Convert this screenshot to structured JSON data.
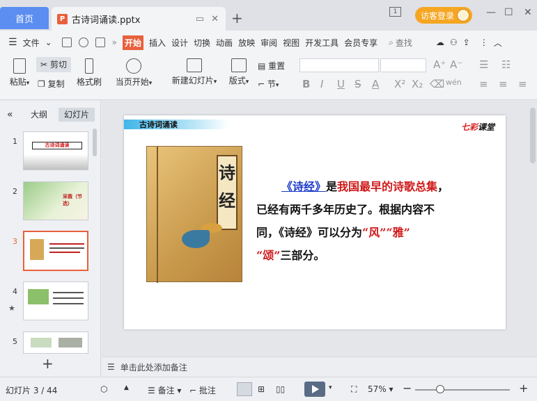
{
  "titlebar": {
    "home_tab": "首页",
    "doc_tab": "古诗词诵读.pptx",
    "file_badge": "P",
    "add_tab": "+",
    "visitor_login": "访客登录",
    "page_badge": "1"
  },
  "menubar": {
    "items": [
      "文件",
      "开始",
      "插入",
      "设计",
      "切换",
      "动画",
      "放映",
      "审阅",
      "视图",
      "开发工具",
      "会员专享"
    ],
    "active_item": "开始",
    "search": "查找"
  },
  "ribbon": {
    "paste": "粘贴",
    "cut": "剪切",
    "copy": "复制",
    "format_painter": "格式刷",
    "start_from_current": "当页开始",
    "new_slide": "新建幻灯片",
    "layout": "版式",
    "reset": "重置",
    "section": "节",
    "font_bold": "B",
    "font_italic": "I",
    "font_underline": "U",
    "font_strike": "S",
    "font_color": "A",
    "superscript": "X²",
    "subscript": "X₂",
    "pinyin": "wén"
  },
  "leftpanel": {
    "tab_outline": "大纲",
    "tab_slides": "幻灯片",
    "thumb_numbers": [
      "1",
      "2",
      "3",
      "4",
      "5"
    ],
    "thumb1_title": "古诗词诵读",
    "thumb2_title": "采薇（节选）",
    "add_slide": "+"
  },
  "slide": {
    "header_band": "古诗词诵读",
    "brand_red": "七彩",
    "brand_black": "课堂",
    "book_title": "诗经",
    "line1_title": "《诗经》",
    "line1_mid": "是",
    "line1_red": "我国最早的诗歌总集",
    "line1_end": "，",
    "line2": "已经有两千多年历史了。根据内容不",
    "line3_start": "同，《诗经》可以分为",
    "line3_red": "“风”“雅”",
    "line4_red": "“颂”",
    "line4_end": "三部分。"
  },
  "notes": {
    "placeholder": "单击此处添加备注"
  },
  "status": {
    "slide_count": "幻灯片 3 / 44",
    "notes_btn": "备注",
    "comment_btn": "批注",
    "zoom": "57%",
    "zoom_minus": "−",
    "zoom_plus": "+"
  }
}
